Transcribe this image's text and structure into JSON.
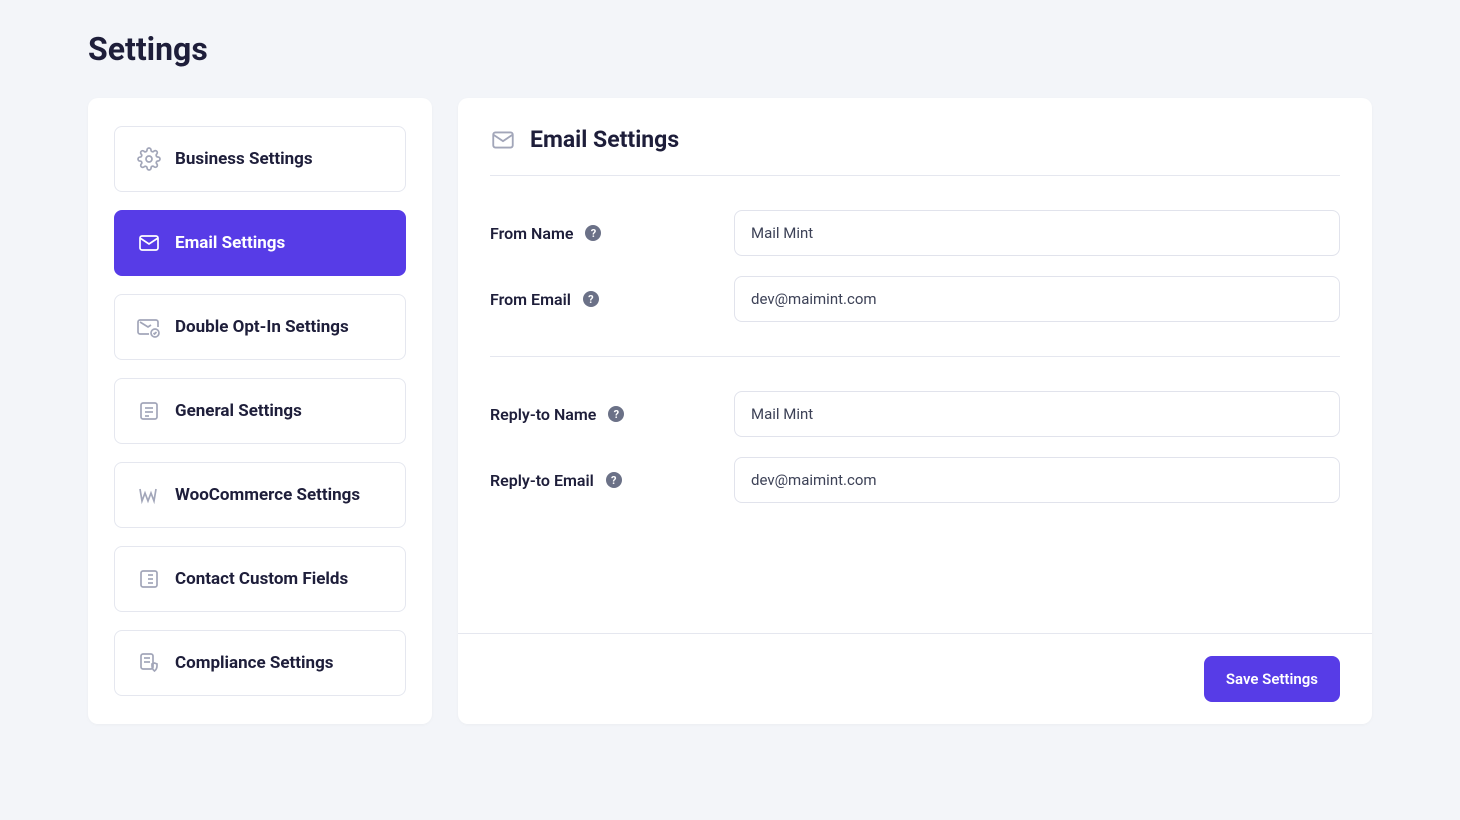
{
  "page_title": "Settings",
  "sidebar": {
    "items": [
      {
        "label": "Business Settings"
      },
      {
        "label": "Email Settings"
      },
      {
        "label": "Double Opt-In Settings"
      },
      {
        "label": "General Settings"
      },
      {
        "label": "WooCommerce Settings"
      },
      {
        "label": "Contact Custom Fields"
      },
      {
        "label": "Compliance Settings"
      }
    ]
  },
  "main": {
    "title": "Email Settings",
    "fields": {
      "from_name": {
        "label": "From Name",
        "value": "Mail Mint"
      },
      "from_email": {
        "label": "From Email",
        "value": "dev@maimint.com"
      },
      "reply_name": {
        "label": "Reply-to Name",
        "value": "Mail Mint"
      },
      "reply_email": {
        "label": "Reply-to Email",
        "value": "dev@maimint.com"
      }
    },
    "save_label": "Save Settings"
  }
}
